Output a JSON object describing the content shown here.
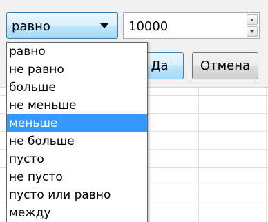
{
  "filter": {
    "condition_value": "равно",
    "value": "10000"
  },
  "buttons": {
    "ok_label": "Да",
    "cancel_label": "Отмена"
  },
  "dropdown": {
    "selected_index": 4,
    "items": [
      "равно",
      "не равно",
      "больше",
      "не меньше",
      "меньше",
      "не больше",
      "пусто",
      "не пусто",
      "пусто или равно",
      "между"
    ]
  },
  "colors": {
    "selected_item_bg": "#3399ff",
    "selected_item_text": "#ffffff",
    "select_border": "#3c7fb1"
  },
  "icons": {
    "dropdown_arrow": "chevron-down-icon",
    "spin_up": "spin-up-icon",
    "spin_down": "spin-down-icon"
  }
}
